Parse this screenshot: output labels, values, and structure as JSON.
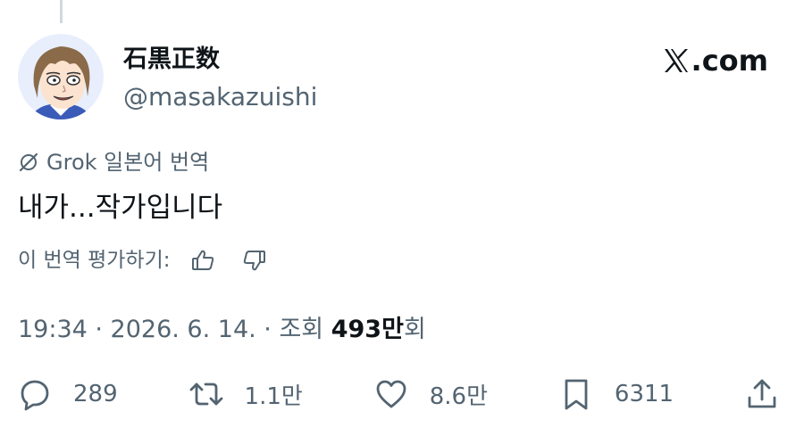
{
  "author": {
    "display_name": "石黒正数",
    "handle": "@masakazuishi"
  },
  "source_watermark": "X.com",
  "translation": {
    "label": "Grok 일본어 번역",
    "icon": "grok-icon",
    "text": "내가...작가입니다",
    "rate_label": "이 번역 평가하기:"
  },
  "meta": {
    "time_date": "19:34 · 2026. 6. 14. · 조회 ",
    "views_count": "493만",
    "views_suffix": "회"
  },
  "actions": {
    "replies": "289",
    "reposts": "1.1만",
    "likes": "8.6만",
    "bookmarks": "6311"
  },
  "colors": {
    "text_primary": "#0f1419",
    "text_secondary": "#536471",
    "thread_line": "#cfd9de",
    "background": "#ffffff"
  }
}
